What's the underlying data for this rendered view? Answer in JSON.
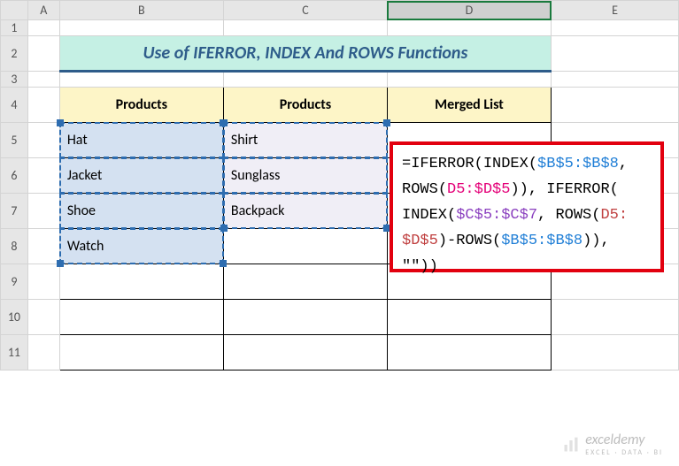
{
  "columns": [
    "",
    "A",
    "B",
    "C",
    "D",
    "E"
  ],
  "rows": [
    "1",
    "2",
    "3",
    "4",
    "5",
    "6",
    "7",
    "8",
    "9",
    "10",
    "11"
  ],
  "selected_column": "D",
  "title": "Use of IFERROR, INDEX And ROWS Functions",
  "headers": {
    "b": "Products",
    "c": "Products",
    "d": "Merged List"
  },
  "dataB": [
    "Hat",
    "Jacket",
    "Shoe",
    "Watch"
  ],
  "dataC": [
    "Shirt",
    "Sunglass",
    "Backpack"
  ],
  "formula": {
    "eq": "=",
    "f1": "IFERROR",
    "f2": "INDEX",
    "f3": "ROWS",
    "ref_b": "$B$5:$B$8",
    "ref_d": "D5:$D$5",
    "ref_c": "$C$5:$C$7",
    "comma": ", ",
    "dash": "-",
    "q": "\"\"",
    "op": "(",
    "cp": ")",
    "colon": ":"
  },
  "watermark": "exceldemy",
  "watermark_sub": "EXCEL · DATA · BI"
}
